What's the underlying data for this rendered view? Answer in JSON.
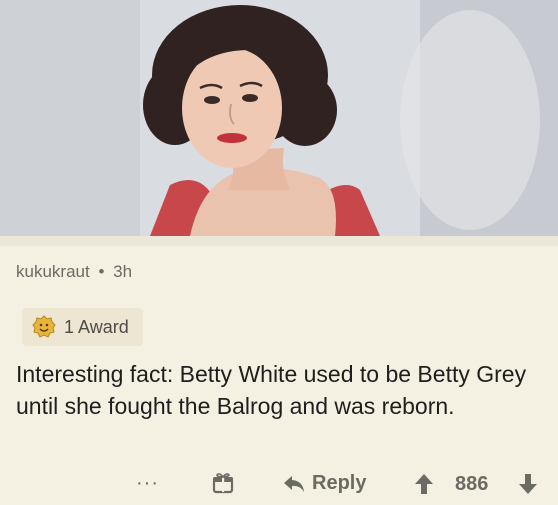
{
  "photo": {
    "subject": "vintage portrait of a woman with dark curled hair in a red dress"
  },
  "comment": {
    "username": "kukukraut",
    "separator": "•",
    "age": "3h",
    "award_label": "1 Award",
    "body": "Interesting fact: Betty White used to be Betty Grey until she fought the Balrog and was reborn."
  },
  "actions": {
    "more_label": "···",
    "reply_label": "Reply",
    "score": "886"
  },
  "icons": {
    "award": "award-badge-icon",
    "gift": "gift-icon",
    "reply": "reply-arrow-icon",
    "upvote": "upvote-arrow-icon",
    "downvote": "downvote-arrow-icon"
  },
  "colors": {
    "background": "#f5f1e2",
    "meta_text": "#6b6a63",
    "body_text": "#1e1e1e",
    "dress_red": "#c8474a"
  }
}
